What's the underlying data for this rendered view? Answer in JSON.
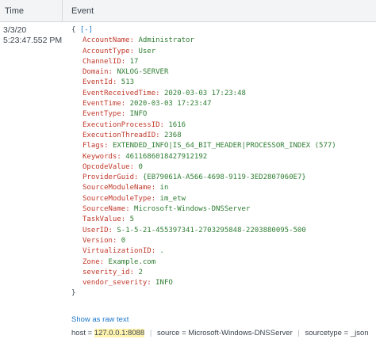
{
  "header": {
    "time_label": "Time",
    "event_label": "Event"
  },
  "row": {
    "date": "3/3/20",
    "time": "5:23:47.552 PM",
    "toggle": "[-]",
    "open_brace": "{",
    "close_brace": "}",
    "fields": [
      {
        "key": "AccountName",
        "value": "Administrator",
        "type": "str"
      },
      {
        "key": "AccountType",
        "value": "User",
        "type": "str"
      },
      {
        "key": "ChannelID",
        "value": "17",
        "type": "num"
      },
      {
        "key": "Domain",
        "value": "NXLOG-SERVER",
        "type": "str"
      },
      {
        "key": "EventId",
        "value": "513",
        "type": "num"
      },
      {
        "key": "EventReceivedTime",
        "value": "2020-03-03 17:23:48",
        "type": "str"
      },
      {
        "key": "EventTime",
        "value": "2020-03-03 17:23:47",
        "type": "str"
      },
      {
        "key": "EventType",
        "value": "INFO",
        "type": "str"
      },
      {
        "key": "ExecutionProcessID",
        "value": "1616",
        "type": "num"
      },
      {
        "key": "ExecutionThreadID",
        "value": "2368",
        "type": "num"
      },
      {
        "key": "Flags",
        "value": "EXTENDED_INFO|IS_64_BIT_HEADER|PROCESSOR_INDEX (577)",
        "type": "str"
      },
      {
        "key": "Keywords",
        "value": "4611686018427912192",
        "type": "num"
      },
      {
        "key": "OpcodeValue",
        "value": "0",
        "type": "num"
      },
      {
        "key": "ProviderGuid",
        "value": "{EB79061A-A566-4698-9119-3ED2807060E7}",
        "type": "str"
      },
      {
        "key": "SourceModuleName",
        "value": "in",
        "type": "str"
      },
      {
        "key": "SourceModuleType",
        "value": "im_etw",
        "type": "str"
      },
      {
        "key": "SourceName",
        "value": "Microsoft-Windows-DNSServer",
        "type": "str"
      },
      {
        "key": "TaskValue",
        "value": "5",
        "type": "num"
      },
      {
        "key": "UserID",
        "value": "S-1-5-21-455397341-2703295848-2203880095-500",
        "type": "str"
      },
      {
        "key": "Version",
        "value": "0",
        "type": "num"
      },
      {
        "key": "VirtualizationID",
        "value": ".",
        "type": "str"
      },
      {
        "key": "Zone",
        "value": "Example.com",
        "type": "str"
      },
      {
        "key": "severity_id",
        "value": "2",
        "type": "num"
      },
      {
        "key": "vendor_severity",
        "value": "INFO",
        "type": "str"
      }
    ],
    "raw_link": "Show as raw text",
    "meta": {
      "host_key": "host",
      "host_value": "127.0.0.1:8088",
      "source_key": "source",
      "source_value": "Microsoft-Windows-DNSServer",
      "sourcetype_key": "sourcetype",
      "sourcetype_value": "_json"
    }
  }
}
